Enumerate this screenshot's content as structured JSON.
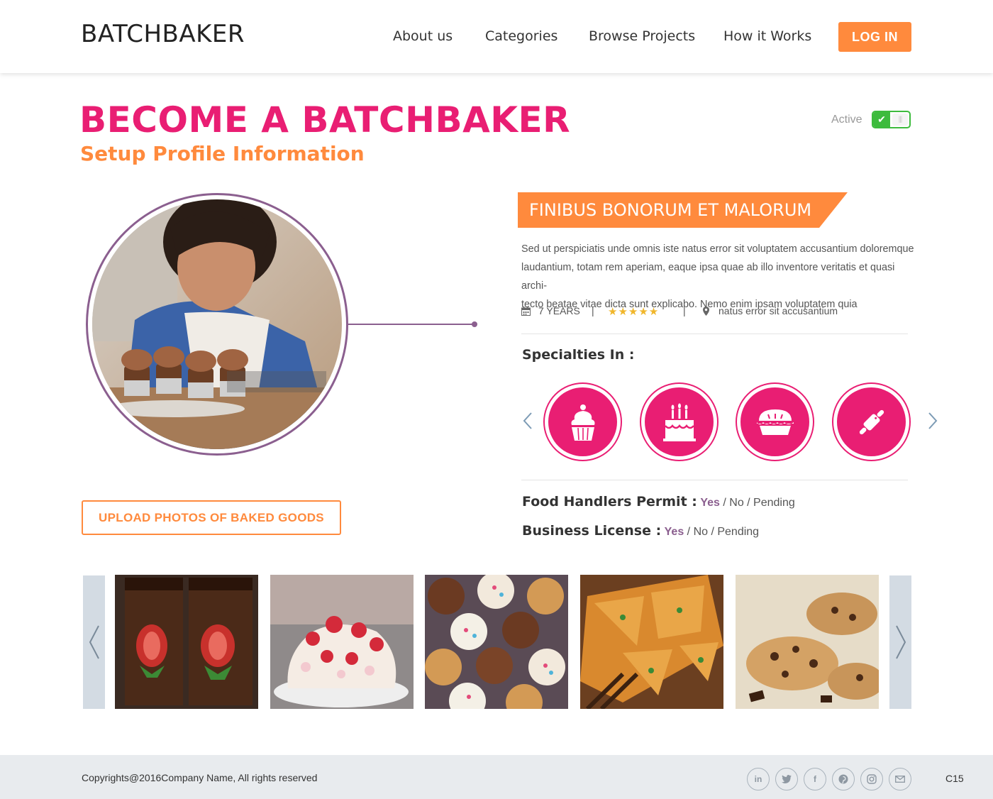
{
  "header": {
    "logo": "BATCHBAKER",
    "nav": [
      "About us",
      "Categories",
      "Browse Projects",
      "How it Works"
    ],
    "login_label": "LOG IN"
  },
  "page": {
    "title": "BECOME A BATCHBAKER",
    "subtitle": "Setup Profile Information",
    "status_label": "Active",
    "status_active": true,
    "upload_label": "UPLOAD PHOTOS OF BAKED GOODS"
  },
  "profile": {
    "heading": "FINIBUS BONORUM ET MALORUM",
    "description_lines": [
      "Sed ut perspiciatis unde omnis iste natus error sit voluptatem accusantium doloremque",
      "laudantium, totam rem aperiam, eaque ipsa quae ab illo inventore veritatis et quasi archi-",
      "tecto beatae vitae dicta sunt explicabo. Nemo enim ipsam voluptatem quia"
    ],
    "experience": "7 YEARS",
    "rating": 5,
    "separator": "|",
    "location": "natus error sit  accusantium",
    "specialties_title": "Specialties In :",
    "specialties": [
      "cupcake-icon",
      "birthday-cake-icon",
      "pie-icon",
      "rolling-pin-icon"
    ],
    "food_permit": {
      "label": "Food Handlers Permit :",
      "yes": "Yes",
      "rest": " / No / Pending"
    },
    "business_license": {
      "label": "Business License :",
      "yes": "Yes",
      "rest": " / No / Pending"
    }
  },
  "gallery": [
    "brownie-strawberry-photo",
    "strawberry-pavlova-photo",
    "cupcakes-photo",
    "pie-photo",
    "cookies-photo"
  ],
  "footer": {
    "copyright": "Copyrights@2016Company Name, All rights reserved",
    "social": [
      "linkedin-icon",
      "twitter-icon",
      "facebook-icon",
      "pinterest-icon",
      "instagram-icon",
      "mail-icon"
    ],
    "code": "C15"
  },
  "colors": {
    "brand_pink": "#e91e73",
    "brand_orange": "#ff8a3d",
    "accent_purple": "#8b5f8f",
    "active_green": "#3dbb3d"
  }
}
